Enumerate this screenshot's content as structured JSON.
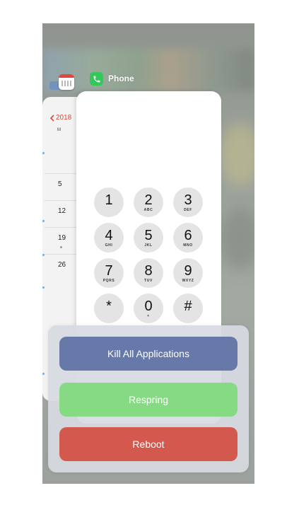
{
  "switcher": {
    "app_label": "Phone",
    "calendar_year": "2018",
    "calendar_weekday": "M",
    "calendar_dates": [
      "5",
      "12",
      "19",
      "26"
    ]
  },
  "keypad": {
    "keys": [
      {
        "digit": "1",
        "letters": ""
      },
      {
        "digit": "2",
        "letters": "ABC"
      },
      {
        "digit": "3",
        "letters": "DEF"
      },
      {
        "digit": "4",
        "letters": "GHI"
      },
      {
        "digit": "5",
        "letters": "JKL"
      },
      {
        "digit": "6",
        "letters": "MNO"
      },
      {
        "digit": "7",
        "letters": "PQRS"
      },
      {
        "digit": "8",
        "letters": "TUV"
      },
      {
        "digit": "9",
        "letters": "WXYZ"
      },
      {
        "digit": "*",
        "letters": ""
      },
      {
        "digit": "0",
        "letters": "+"
      },
      {
        "digit": "#",
        "letters": ""
      }
    ]
  },
  "actions": {
    "kill_all": "Kill All Applications",
    "respring": "Respring",
    "reboot": "Reboot"
  },
  "colors": {
    "kill_all": "#6679a8",
    "respring": "#86da84",
    "reboot": "#d3584e",
    "phone_icon": "#34c759",
    "calendar_accent": "#e2463c"
  }
}
